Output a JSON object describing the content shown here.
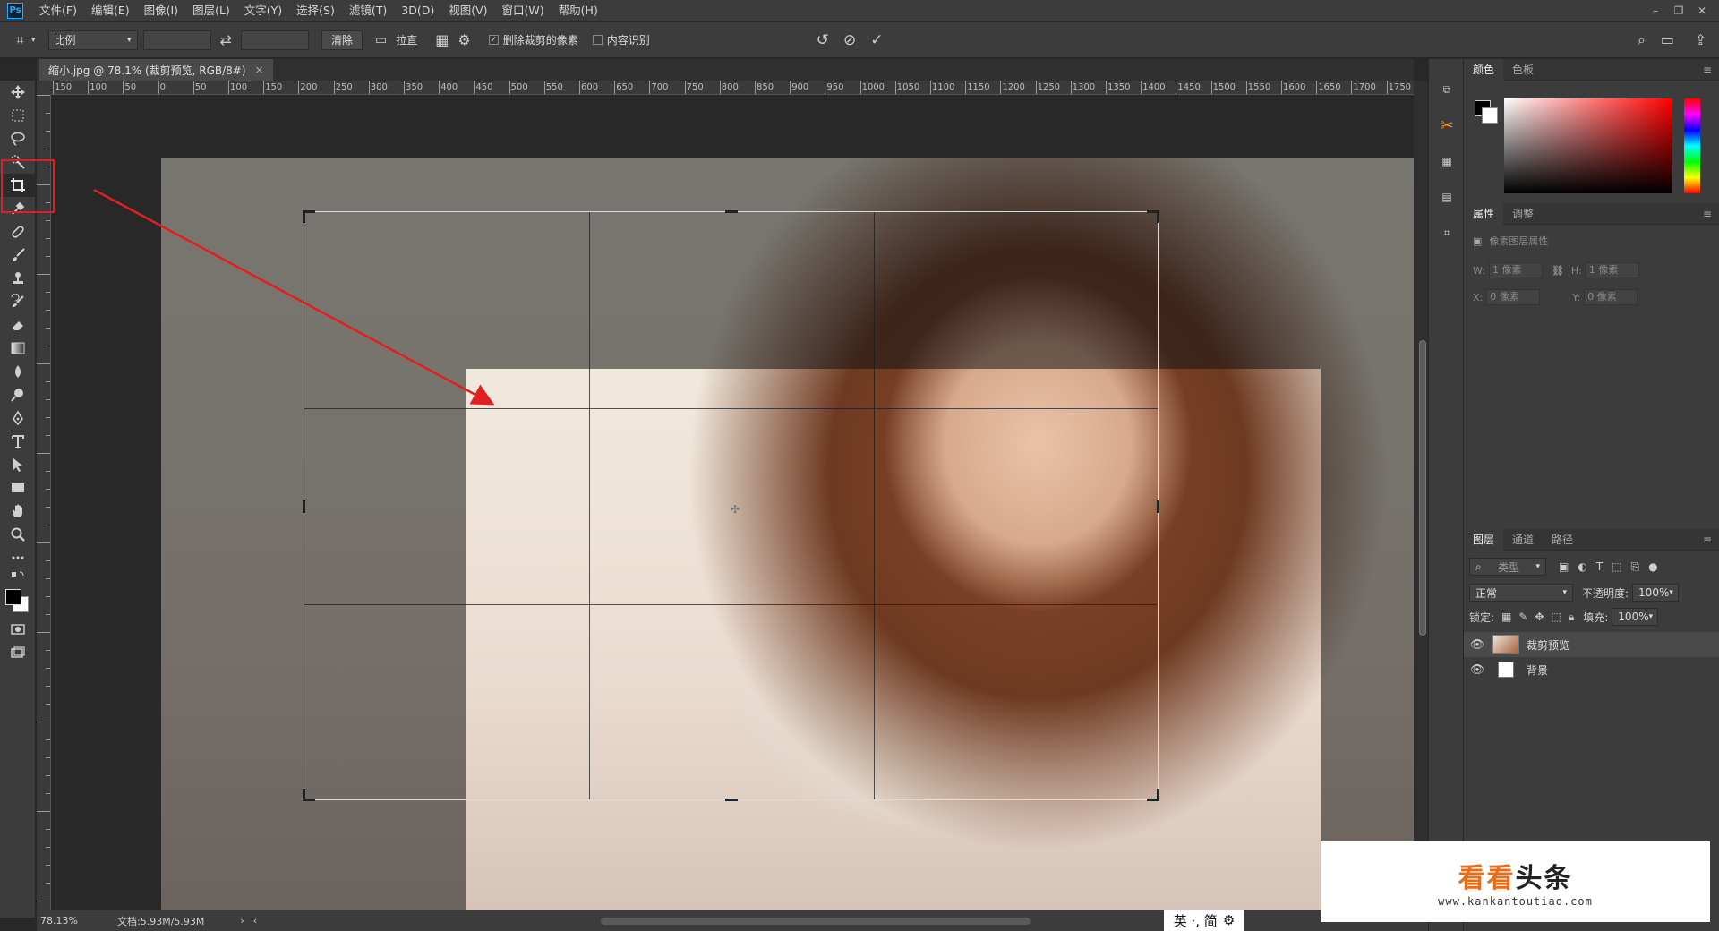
{
  "app": {
    "logo": "Ps"
  },
  "menu": [
    "文件(F)",
    "编辑(E)",
    "图像(I)",
    "图层(L)",
    "文字(Y)",
    "选择(S)",
    "滤镜(T)",
    "3D(D)",
    "视图(V)",
    "窗口(W)",
    "帮助(H)"
  ],
  "options": {
    "ratio_select": "比例",
    "clear_button": "清除",
    "straighten_button": "拉直",
    "delete_cropped_label": "删除裁剪的像素",
    "content_aware_label": "内容识别"
  },
  "document": {
    "tab_title": "缩小.jpg @ 78.1% (裁剪预览, RGB/8#)"
  },
  "ruler_h_labels": [
    "150",
    "100",
    "50",
    "0",
    "50",
    "100",
    "150",
    "200",
    "250",
    "300",
    "350",
    "400",
    "450",
    "500",
    "550",
    "600",
    "650",
    "700",
    "750",
    "800",
    "850",
    "900",
    "950",
    "1000",
    "1050",
    "1100",
    "1150",
    "1200",
    "1250",
    "1300",
    "1350",
    "1400",
    "1450",
    "1500",
    "1550",
    "1600",
    "1650",
    "1700",
    "1750"
  ],
  "status": {
    "zoom": "78.13%",
    "doc_size": "文档:5.93M/5.93M"
  },
  "color_panel": {
    "tabs": [
      "颜色",
      "色板"
    ]
  },
  "properties_panel": {
    "tabs": [
      "属性",
      "调整"
    ],
    "title": "像素图层属性",
    "w_label": "W:",
    "w_value": "1 像素",
    "h_label": "H:",
    "h_value": "1 像素",
    "x_label": "X:",
    "x_value": "0 像素",
    "y_label": "Y:",
    "y_value": "0 像素"
  },
  "layers_panel": {
    "tabs": [
      "图层",
      "通道",
      "路径"
    ],
    "filter_placeholder": "类型",
    "blend_mode": "正常",
    "opacity_label": "不透明度:",
    "opacity_value": "100%",
    "lock_label": "锁定:",
    "fill_label": "填充:",
    "fill_value": "100%",
    "layers": [
      {
        "name": "裁剪预览",
        "selected": true
      },
      {
        "name": "背景",
        "selected": false
      }
    ]
  },
  "watermark": {
    "title_a": "看看",
    "title_b": "头条",
    "url": "www.kankantoutiao.com"
  },
  "ime": {
    "text": "英 ·, 简"
  },
  "colors": {
    "annotation": "#e02020",
    "accent": "#31a8ff",
    "watermark_orange": "#e86c1a"
  }
}
